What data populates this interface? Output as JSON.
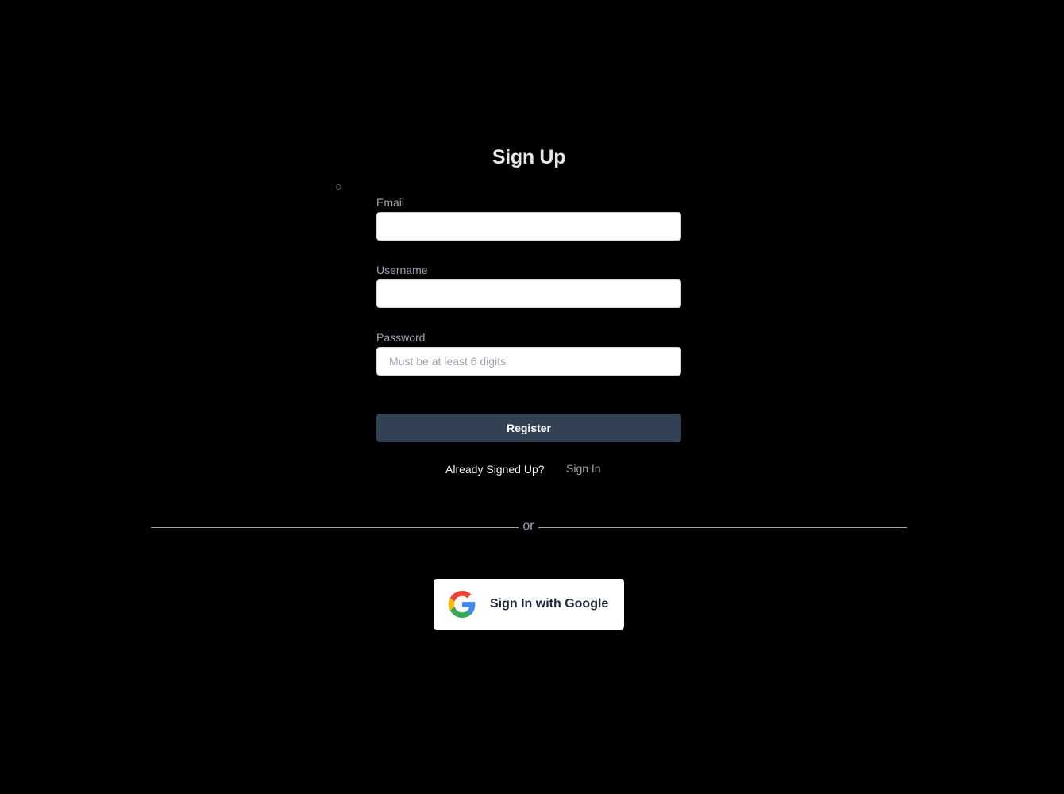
{
  "form": {
    "title": "Sign Up",
    "email": {
      "label": "Email",
      "value": "",
      "placeholder": ""
    },
    "username": {
      "label": "Username",
      "value": "",
      "placeholder": ""
    },
    "password": {
      "label": "Password",
      "value": "",
      "placeholder": "Must be at least 6 digits"
    },
    "register_label": "Register",
    "already_text": "Already Signed Up?",
    "signin_link": "Sign In"
  },
  "divider": {
    "text": "or"
  },
  "google": {
    "label": "Sign In with Google",
    "icon": "google-icon"
  },
  "colors": {
    "background": "#000000",
    "register_button": "#334155",
    "label_text": "#9ca3af",
    "title_text": "#e5e7eb"
  }
}
